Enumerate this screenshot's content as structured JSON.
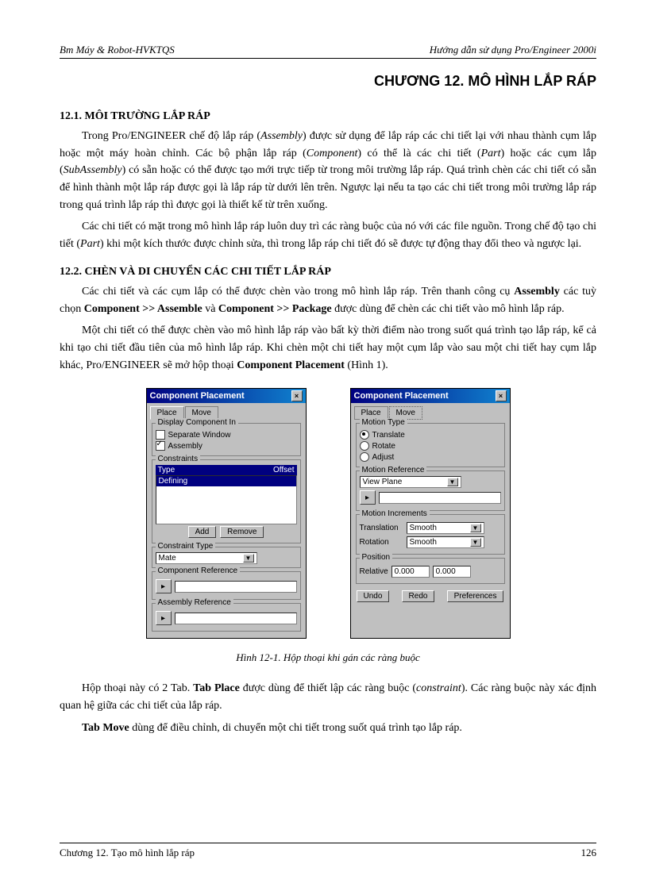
{
  "header": {
    "left": "Bm Máy & Robot-HVKTQS",
    "right": "Hướng dẫn sử dụng Pro/Engineer 2000i"
  },
  "chapter_title": "CHƯƠNG 12. MÔ HÌNH LẮP RÁP",
  "section_12_1": "12.1.   MÔI TRƯỜNG LẮP RÁP",
  "para1_a": "Trong Pro/ENGINEER chế độ lắp ráp (",
  "para1_b": "Assembly",
  "para1_c": ") được sử dụng để lắp ráp các chi tiết lại với nhau thành cụm lắp hoặc một máy hoàn chỉnh. Các bộ phận lắp ráp (",
  "para1_d": "Component",
  "para1_e": ") có thể là các chi tiết (",
  "para1_f": "Part",
  "para1_g": ") hoặc các cụm lắp (",
  "para1_h": "SubAssembly",
  "para1_i": ") có sẵn hoặc có thể được tạo mới trực tiếp từ trong môi trường lắp ráp. Quá trình chèn các chi tiết có sẵn để hình thành một lắp ráp được gọi là lắp ráp từ dưới lên trên. Ngược lại nếu ta tạo các chi tiết trong môi trường lắp ráp trong quá trình lắp ráp thì được gọi là thiết kế từ trên xuống.",
  "para2_a": "Các chi tiết có mặt trong mô hình lắp ráp luôn duy trì các ràng buộc của nó với các file nguồn. Trong chế độ tạo chi tiết (",
  "para2_b": "Part",
  "para2_c": ") khi một kích thước được chỉnh sửa, thì trong lắp ráp chi tiết đó sẽ được tự động thay đổi theo và ngược lại.",
  "section_12_2": "12.2.   CHÈN VÀ DI CHUYỂN CÁC CHI TIẾT LẮP RÁP",
  "para3_a": "Các chi tiết và các cụm lắp có thể được chèn vào trong mô hình lắp ráp. Trên thanh công cụ ",
  "para3_b": "Assembly",
  "para3_c": " các tuỳ chọn ",
  "para3_d": "Component >> Assemble",
  "para3_e": " và ",
  "para3_f": "Component >> Package",
  "para3_g": " được dùng để chèn các chi tiết vào mô hình lắp ráp.",
  "para4_a": "Một chi tiết có thể được chèn vào mô hình lắp ráp vào bất kỳ thời điểm nào trong suốt quá trình tạo lắp ráp, kể cả khi tạo chi tiết đầu tiên của mô hình lắp ráp. Khi chèn một chi tiết hay một cụm lắp vào sau một chi tiết hay cụm lắp khác, Pro/ENGINEER sẽ mở hộp thoại ",
  "para4_b": "Component Placement",
  "para4_c": " (Hình 1).",
  "dialog_left": {
    "title": "Component Placement",
    "tab_place": "Place",
    "tab_move": "Move",
    "group_display": "Display Component In",
    "chk_sepwin": "Separate Window",
    "chk_assembly": "Assembly",
    "group_constraints": "Constraints",
    "col_type": "Type",
    "col_offset": "Offset",
    "item_defining": "Defining",
    "btn_add": "Add",
    "btn_remove": "Remove",
    "group_ctype": "Constraint Type",
    "ctype_val": "Mate",
    "group_compref": "Component Reference",
    "group_asmref": "Assembly Reference"
  },
  "dialog_right": {
    "title": "Component Placement",
    "tab_place": "Place",
    "tab_move": "Move",
    "group_motion": "Motion Type",
    "radio_translate": "Translate",
    "radio_rotate": "Rotate",
    "radio_adjust": "Adjust",
    "group_ref": "Motion Reference",
    "ref_val": "View Plane",
    "group_incr": "Motion Increments",
    "lbl_translation": "Translation",
    "val_smooth1": "Smooth",
    "lbl_rotation": "Rotation",
    "val_smooth2": "Smooth",
    "group_position": "Position",
    "lbl_relative": "Relative",
    "pos1": "0.000",
    "pos2": "0.000",
    "btn_undo": "Undo",
    "btn_redo": "Redo",
    "btn_prefs": "Preferences"
  },
  "figure_caption": "Hình 12-1.    Hộp thoại khi gán các ràng buộc",
  "para5_a": "Hộp thoại này có 2 Tab. ",
  "para5_b": "Tab Place",
  "para5_c": " được dùng để thiết lập các ràng buộc (",
  "para5_d": "constraint",
  "para5_e": "). Các ràng buộc này xác định quan hệ giữa các chi tiết của lắp ráp.",
  "para6_a": "Tab Move",
  "para6_b": " dùng để điều chỉnh, di chuyển một chi tiết trong suốt quá trình tạo lắp ráp.",
  "footer": {
    "left": "Chương 12. Tạo mô hình lắp ráp",
    "right": "126"
  }
}
